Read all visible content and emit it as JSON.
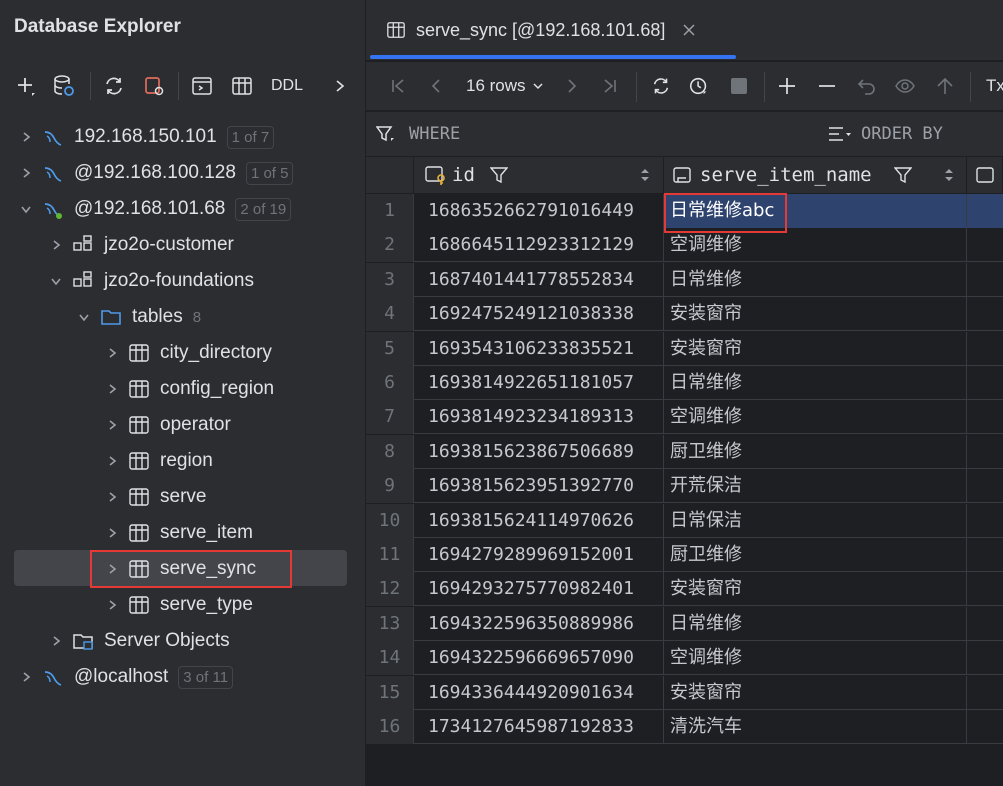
{
  "sidebar": {
    "title": "Database Explorer",
    "toolbar": {
      "ddl_label": "DDL"
    },
    "tree": [
      {
        "label": "192.168.150.101",
        "badge": "1 of 7"
      },
      {
        "label": "@192.168.100.128",
        "badge": "1 of 5"
      },
      {
        "label": "@192.168.101.68",
        "badge": "2 of 19"
      },
      {
        "label": "jzo2o-customer"
      },
      {
        "label": "jzo2o-foundations"
      },
      {
        "label": "tables",
        "count": "8"
      },
      {
        "label": "city_directory"
      },
      {
        "label": "config_region"
      },
      {
        "label": "operator"
      },
      {
        "label": "region"
      },
      {
        "label": "serve"
      },
      {
        "label": "serve_item"
      },
      {
        "label": "serve_sync"
      },
      {
        "label": "serve_type"
      },
      {
        "label": "Server Objects"
      },
      {
        "label": "@localhost",
        "badge": "3 of 11"
      }
    ]
  },
  "editor": {
    "tab_title": "serve_sync [@192.168.101.68]",
    "rows_label": "16 rows",
    "tx_label": "Tx",
    "where_label": "WHERE",
    "order_by_label": "ORDER BY",
    "columns": [
      "id",
      "serve_item_name"
    ],
    "rows": [
      {
        "n": "1",
        "id": "1686352662791016449",
        "name": "日常维修abc"
      },
      {
        "n": "2",
        "id": "1686645112923312129",
        "name": "空调维修"
      },
      {
        "n": "3",
        "id": "1687401441778552834",
        "name": "日常维修"
      },
      {
        "n": "4",
        "id": "1692475249121038338",
        "name": "安装窗帘"
      },
      {
        "n": "5",
        "id": "1693543106233835521",
        "name": "安装窗帘"
      },
      {
        "n": "6",
        "id": "1693814922651181057",
        "name": "日常维修"
      },
      {
        "n": "7",
        "id": "1693814923234189313",
        "name": "空调维修"
      },
      {
        "n": "8",
        "id": "1693815623867506689",
        "name": "厨卫维修"
      },
      {
        "n": "9",
        "id": "1693815623951392770",
        "name": "开荒保洁"
      },
      {
        "n": "10",
        "id": "1693815624114970626",
        "name": "日常保洁"
      },
      {
        "n": "11",
        "id": "1694279289969152001",
        "name": "厨卫维修"
      },
      {
        "n": "12",
        "id": "1694293275770982401",
        "name": "安装窗帘"
      },
      {
        "n": "13",
        "id": "1694322596350889986",
        "name": "日常维修"
      },
      {
        "n": "14",
        "id": "1694322596669657090",
        "name": "空调维修"
      },
      {
        "n": "15",
        "id": "1694336444920901634",
        "name": "安装窗帘"
      },
      {
        "n": "16",
        "id": "1734127645987192833",
        "name": "清洗汽车"
      }
    ]
  },
  "colors": {
    "accent": "#3574f0",
    "highlight": "#e53935",
    "selection": "#2e436e",
    "db_icon": "#4e9ae9",
    "connected_dot": "#5fb832"
  }
}
